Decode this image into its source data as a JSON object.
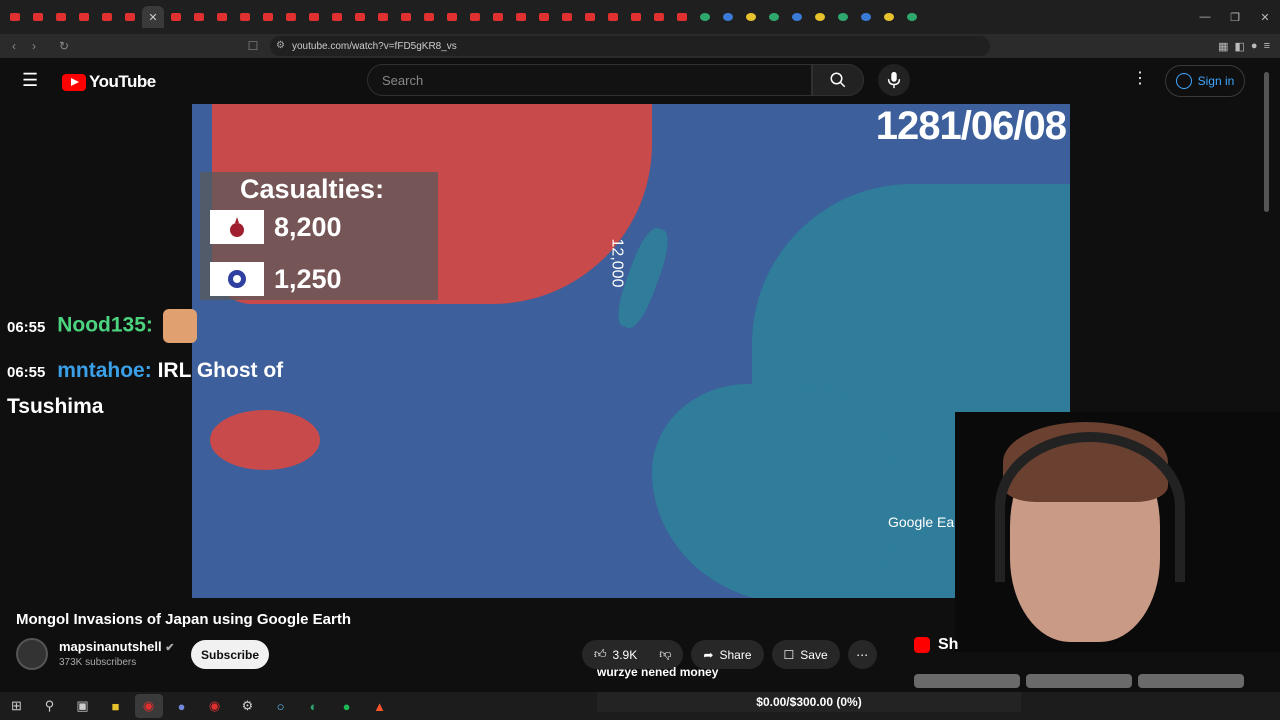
{
  "browser": {
    "url": "youtube.com/watch?v=fFD5gKR8_vs",
    "tabs_count": 40
  },
  "youtube": {
    "logo_text": "YouTube",
    "search_placeholder": "Search",
    "signin_label": "Sign in"
  },
  "video": {
    "date_overlay": "1281/06/08",
    "casualties_title": "Casualties:",
    "mongol_casualties": "8,200",
    "japan_casualties": "1,250",
    "map_annotation": "12,000",
    "watermark": "Google Earth",
    "title": "Mongol Invasions of Japan using Google Earth"
  },
  "channel": {
    "name": "mapsinanutshell",
    "subscribers": "373K subscribers",
    "subscribe_label": "Subscribe"
  },
  "actions": {
    "likes": "3.9K",
    "share": "Share",
    "save": "Save"
  },
  "sidebar": {
    "shorts_label": "Sh"
  },
  "chat": [
    {
      "time": "06:55",
      "user": "Nood135:",
      "message": ""
    },
    {
      "time": "06:55",
      "user": "mntahoe:",
      "message": "IRL Ghost of Tsushima"
    }
  ],
  "stream": {
    "caption": "wurzye nened money",
    "donation_goal": "$0.00/$300.00 (0%)"
  },
  "colors": {
    "youtube_red": "#ff0000",
    "link_blue": "#3ea6ff",
    "chat_green": "#4cd37f",
    "chat_blue": "#3aa0e8"
  }
}
